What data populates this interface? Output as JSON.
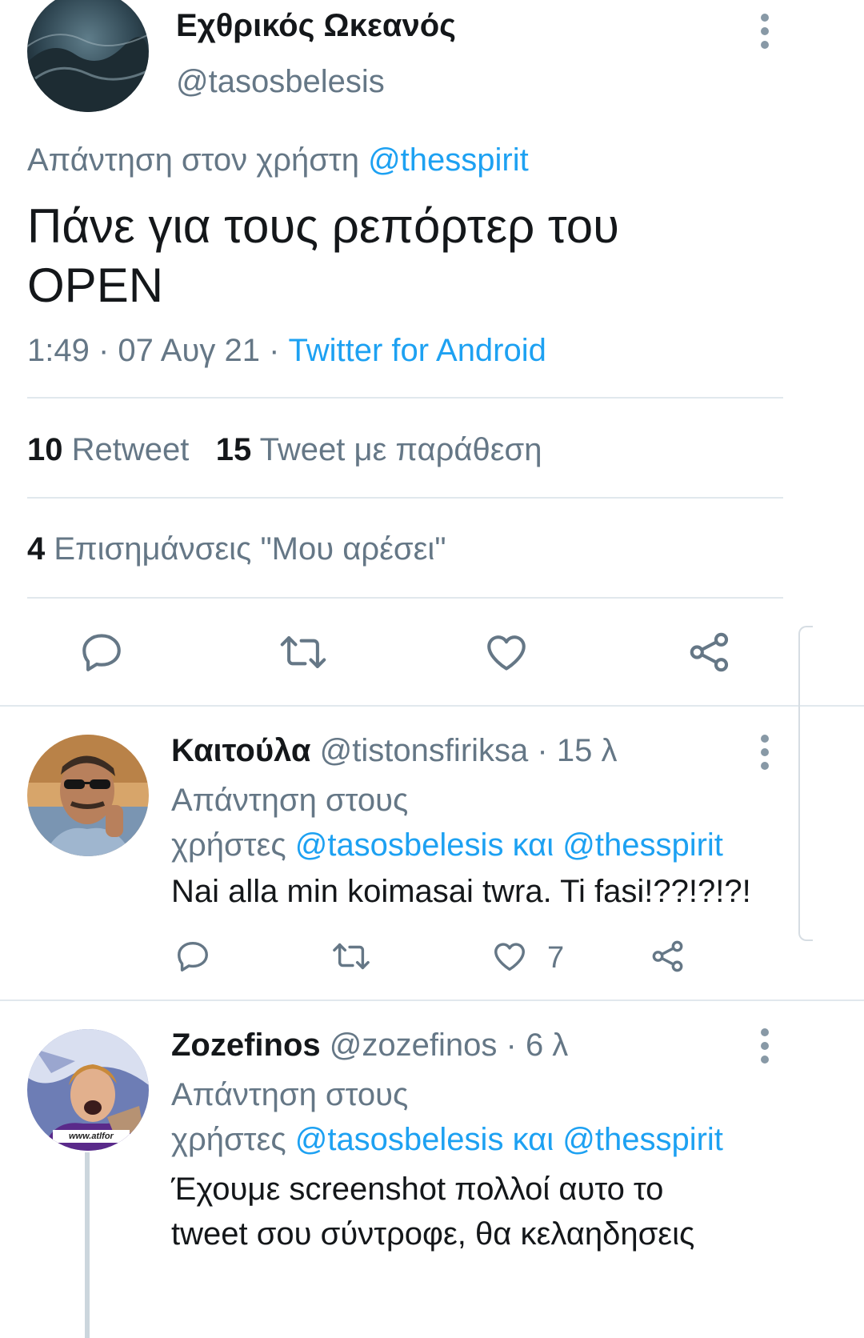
{
  "main_tweet": {
    "display_name": "Εχθρικός Ωκεανός",
    "handle": "@tasosbelesis",
    "reply_prefix": "Απάντηση στον χρήστη",
    "reply_to": "@thesspirit",
    "text_line1": "Πάνε για τους ρεπόρτερ του",
    "text_line2": "OPEN",
    "time_date": "1:49 · 07 Αυγ 21 · ",
    "source": "Twitter for Android",
    "retweets_count": "10",
    "retweets_label": "Retweet",
    "quotes_count": "15",
    "quotes_label": "Tweet με παράθεση",
    "likes_count": "4",
    "likes_label": "Επισημάνσεις \"Μου αρέσει\""
  },
  "replies": [
    {
      "display_name": "Καιτούλα",
      "handle": "@tistonsfiriksa",
      "time": "· 15 λ",
      "reply_line1": "Απάντηση στους",
      "reply_prefix2": "χρήστες",
      "mention1": "@tasosbelesis",
      "and_word": "και",
      "mention2": "@thesspirit",
      "text": "Nai alla min koimasai twra. Ti fasi!??!?!?!",
      "like_count": "7"
    },
    {
      "display_name": "Zozefinos",
      "handle": "@zozefinos",
      "time": "· 6 λ",
      "reply_line1": "Απάντηση στους",
      "reply_prefix2": "χρήστες",
      "mention1": "@tasosbelesis",
      "and_word": "και",
      "mention2": "@thesspirit",
      "text_line1": "Έχουμε screenshot πολλοί αυτο το",
      "text_line2": "tweet σου σύντροφε, θα κελαηδησεις",
      "avatar_watermark": "www.atlfor"
    }
  ],
  "icons": [
    "reply-icon",
    "retweet-icon",
    "like-icon",
    "share-icon",
    "more-icon"
  ],
  "colors": {
    "accent": "#1da1f2",
    "muted": "#657786",
    "divider": "#e1e8ed",
    "icon": "#657786"
  }
}
